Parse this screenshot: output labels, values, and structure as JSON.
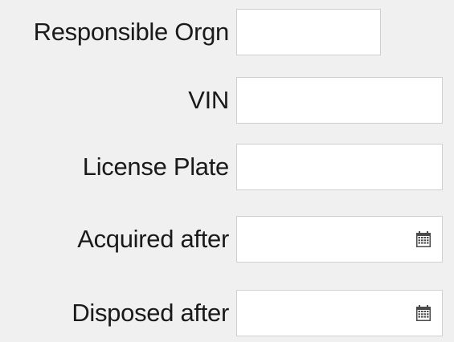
{
  "form": {
    "fields": [
      {
        "label": "Responsible Orgn",
        "value": "",
        "placeholder": ""
      },
      {
        "label": "VIN",
        "value": "",
        "placeholder": ""
      },
      {
        "label": "License Plate",
        "value": "",
        "placeholder": ""
      },
      {
        "label": "Acquired after",
        "value": "",
        "placeholder": "",
        "icon": "calendar-icon"
      },
      {
        "label": "Disposed after",
        "value": "",
        "placeholder": "",
        "icon": "calendar-icon"
      }
    ]
  }
}
